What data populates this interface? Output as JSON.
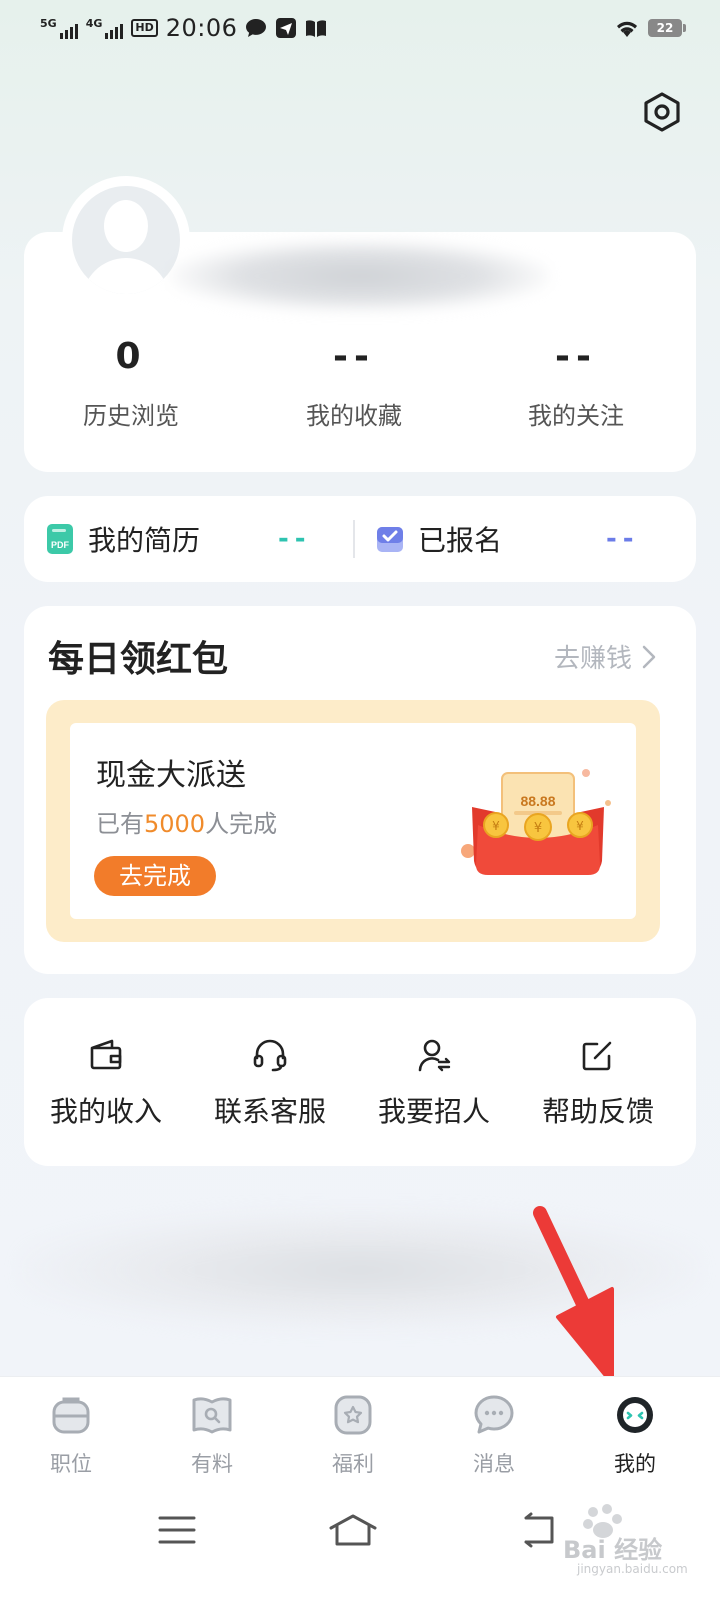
{
  "status_bar": {
    "signal_1": "5G",
    "signal_2": "4G",
    "hd": "HD",
    "time": "20:06",
    "battery": "22",
    "icons": [
      "chat-bubble-icon",
      "paper-plane-icon",
      "book-icon",
      "wifi-icon"
    ]
  },
  "profile": {
    "stats": [
      {
        "value": "0",
        "label": "历史浏览"
      },
      {
        "value": "--",
        "label": "我的收藏"
      },
      {
        "value": "--",
        "label": "我的关注"
      }
    ]
  },
  "quick_row": {
    "resume_label": "我的简历",
    "resume_value": "--",
    "resume_color": "#2ec3b0",
    "applied_label": "已报名",
    "applied_value": "--",
    "applied_color": "#6b7ce8"
  },
  "daily": {
    "title": "每日领红包",
    "earn_link": "去赚钱",
    "promo_title": "现金大派送",
    "promo_prefix": "已有",
    "promo_count": "5000",
    "promo_suffix": "人完成",
    "promo_button": "去完成",
    "packet_amount": "88.88",
    "accent": "#f27c2a"
  },
  "tools": [
    {
      "label": "我的收入",
      "icon": "wallet-icon"
    },
    {
      "label": "联系客服",
      "icon": "headset-icon"
    },
    {
      "label": "我要招人",
      "icon": "recruit-icon"
    },
    {
      "label": "帮助反馈",
      "icon": "edit-icon"
    }
  ],
  "tabs": [
    {
      "label": "职位",
      "icon": "briefcase-icon",
      "active": false
    },
    {
      "label": "有料",
      "icon": "book-search-icon",
      "active": false
    },
    {
      "label": "福利",
      "icon": "gift-star-icon",
      "active": false
    },
    {
      "label": "消息",
      "icon": "message-icon",
      "active": false
    },
    {
      "label": "我的",
      "icon": "profile-face-icon",
      "active": true
    }
  ],
  "watermark": {
    "main": "Bai 经验",
    "sub": "jingyan.baidu.com"
  }
}
